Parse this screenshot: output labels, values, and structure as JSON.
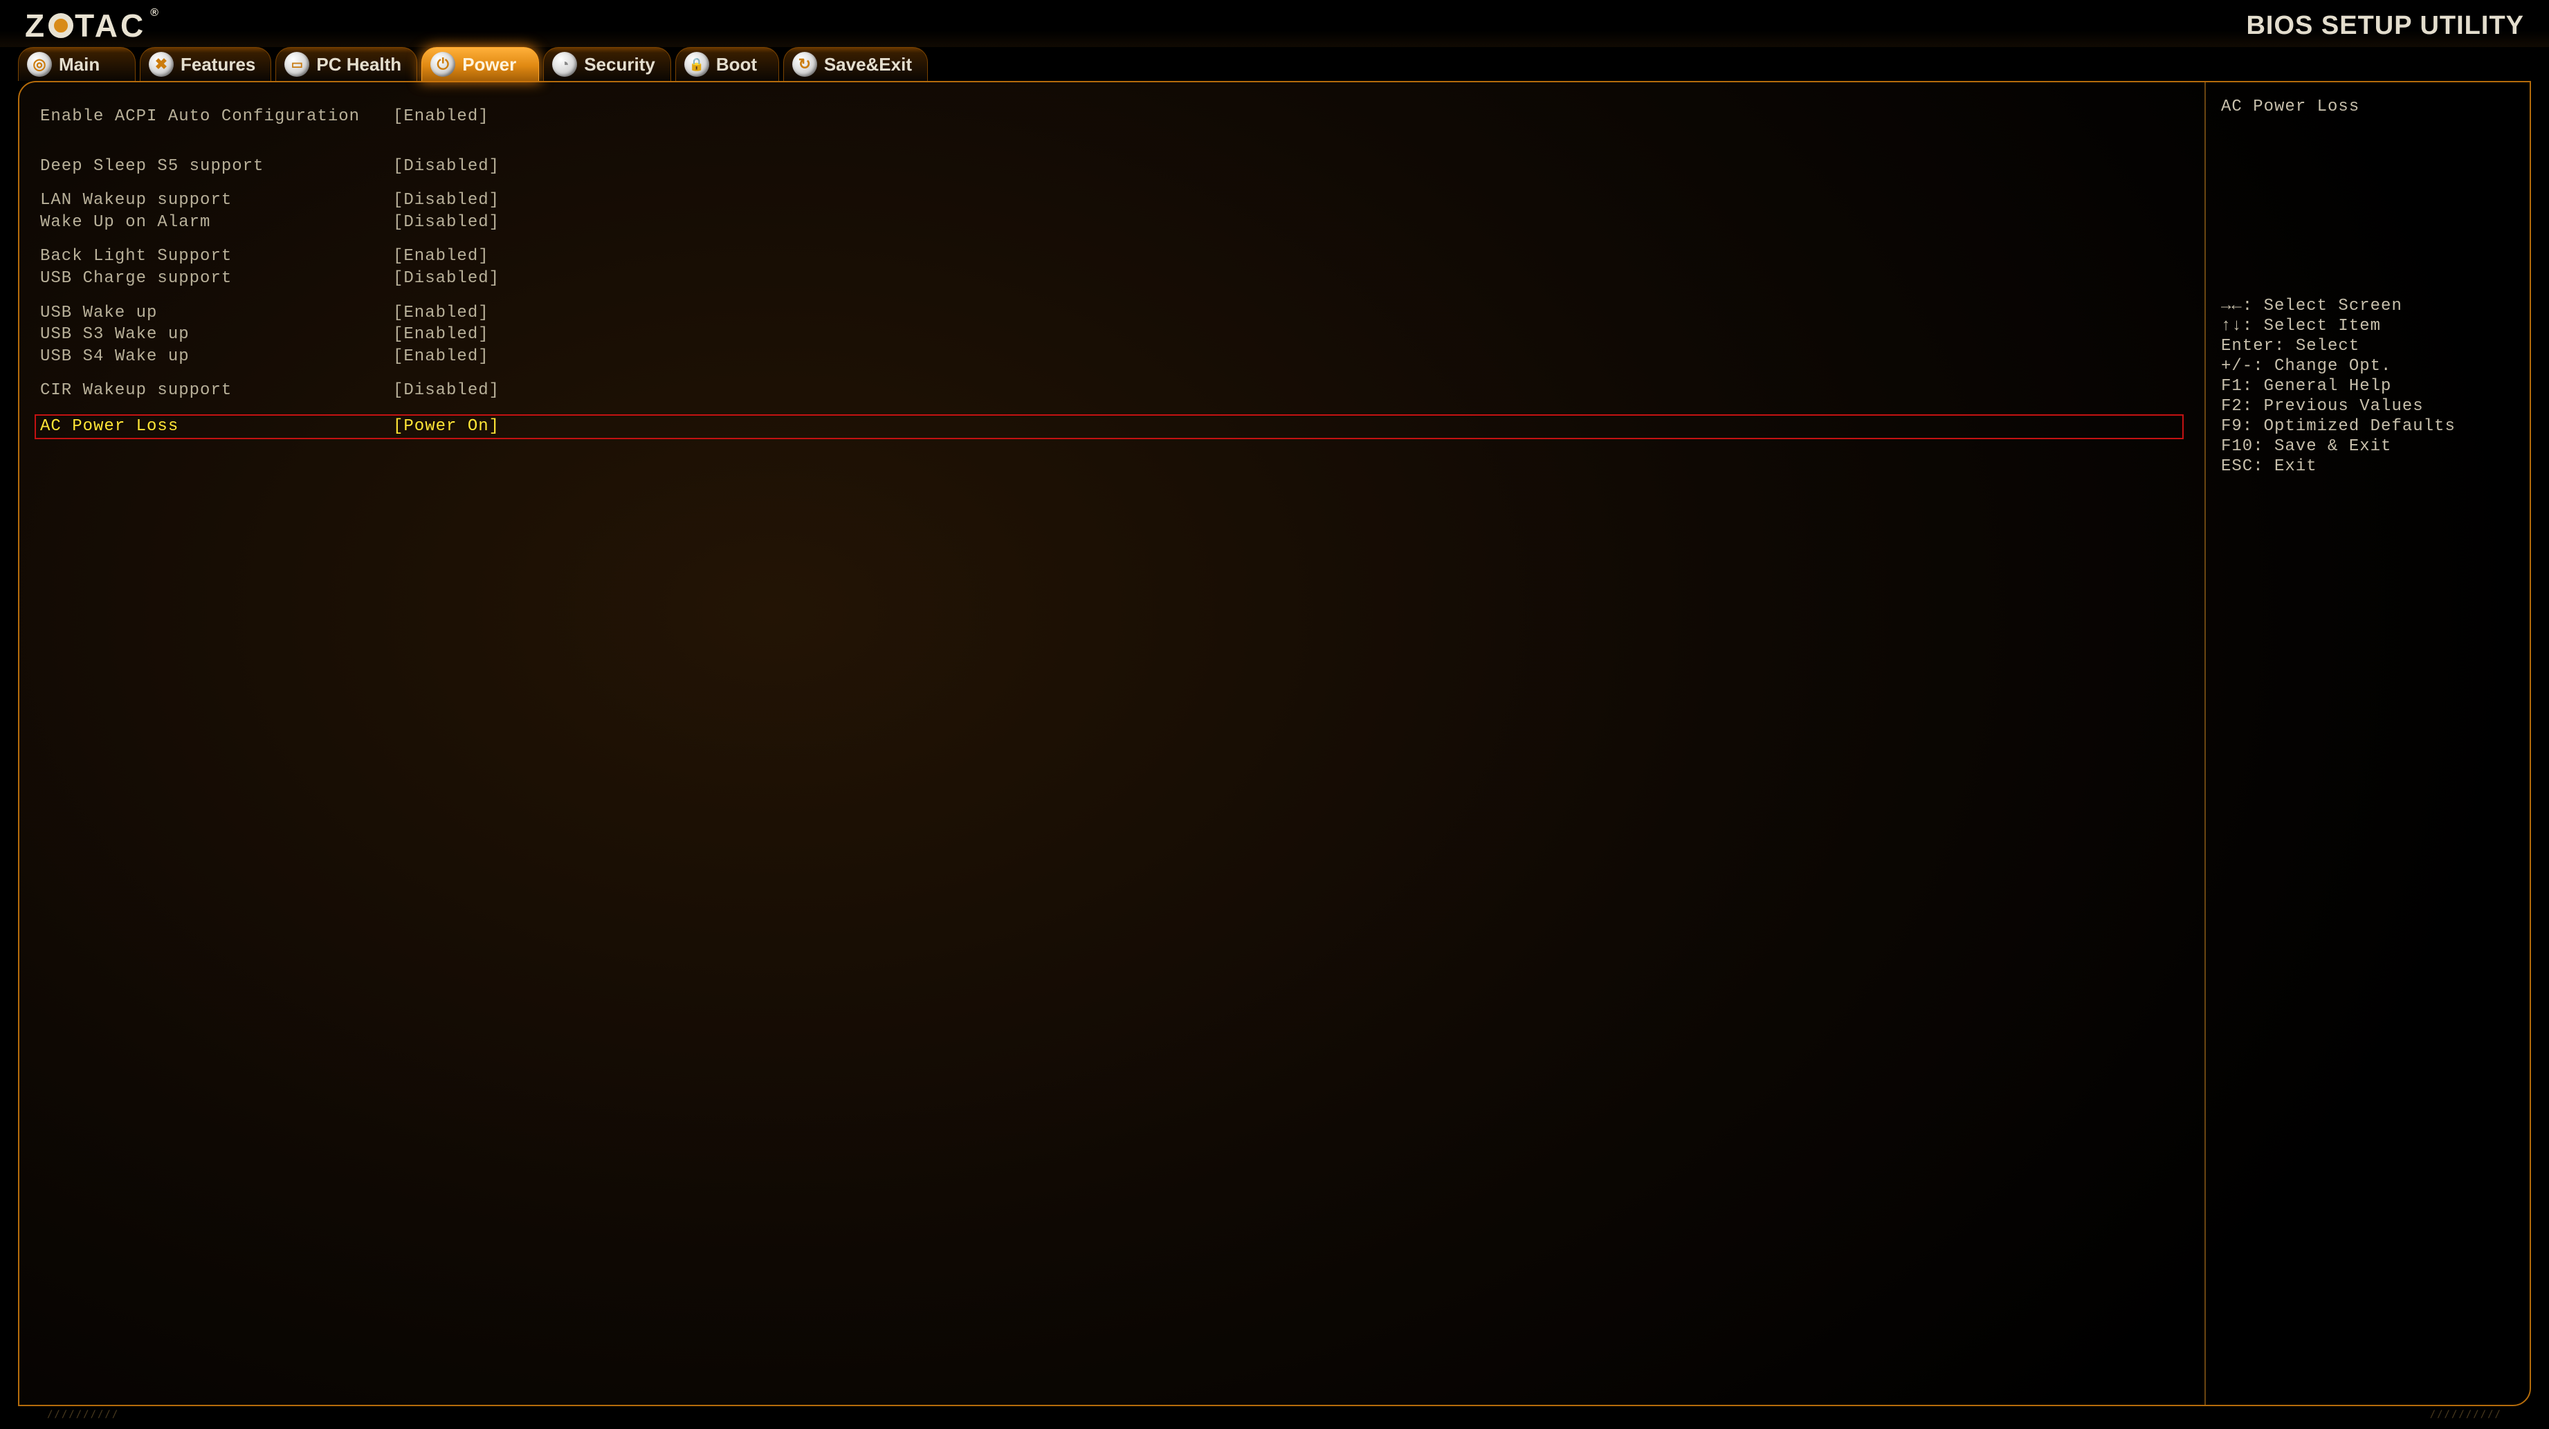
{
  "brand": {
    "name_left": "Z",
    "name_mid": "TAC",
    "reg": "®",
    "title": "BIOS SETUP UTILITY"
  },
  "tabs": [
    {
      "label": "Main",
      "icon": "◎",
      "active": false
    },
    {
      "label": "Features",
      "icon": "✖",
      "active": false
    },
    {
      "label": "PC Health",
      "icon": "▭",
      "active": false
    },
    {
      "label": "Power",
      "icon": "⏻",
      "active": true
    },
    {
      "label": "Security",
      "icon": "◔",
      "active": false
    },
    {
      "label": "Boot",
      "icon": "🔒",
      "active": false
    },
    {
      "label": "Save&Exit",
      "icon": "↻",
      "active": false
    }
  ],
  "settings": [
    {
      "label": "Enable ACPI Auto Configuration",
      "value": "[Enabled]",
      "gap_after": "big"
    },
    {
      "label": "Deep Sleep S5 support",
      "value": "[Disabled]",
      "gap_after": "small"
    },
    {
      "label": "LAN Wakeup support",
      "value": "[Disabled]"
    },
    {
      "label": "Wake Up on Alarm",
      "value": "[Disabled]",
      "gap_after": "small"
    },
    {
      "label": "Back Light Support",
      "value": "[Enabled]"
    },
    {
      "label": "USB Charge support",
      "value": "[Disabled]",
      "gap_after": "small"
    },
    {
      "label": "USB Wake up",
      "value": "[Enabled]"
    },
    {
      "label": "USB S3 Wake up",
      "value": "[Enabled]"
    },
    {
      "label": "USB S4 Wake up",
      "value": "[Enabled]",
      "gap_after": "small"
    },
    {
      "label": "CIR Wakeup support",
      "value": "[Disabled]",
      "gap_after": "small"
    },
    {
      "label": "AC Power Loss",
      "value": "[Power On]",
      "selected": true
    }
  ],
  "help": {
    "title": "AC Power Loss",
    "keys": [
      "→←: Select Screen",
      "↑↓: Select Item",
      "Enter: Select",
      "+/-: Change Opt.",
      "F1: General Help",
      "F2: Previous Values",
      "F9: Optimized Defaults",
      "F10: Save & Exit",
      "ESC: Exit"
    ]
  },
  "vent": "//////////"
}
